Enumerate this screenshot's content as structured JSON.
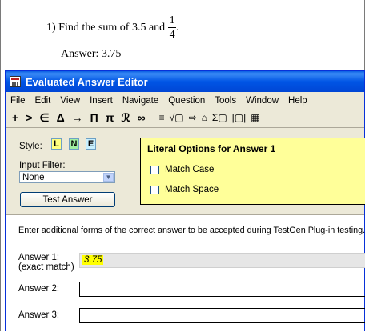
{
  "document": {
    "question_prefix": "1) Find the sum of 3.5 and",
    "fraction_numerator": "1",
    "fraction_denominator": "4",
    "question_suffix": ".",
    "answer_text": "Answer:  3.75"
  },
  "window": {
    "title": "Evaluated Answer Editor",
    "menu": [
      "File",
      "Edit",
      "View",
      "Insert",
      "Navigate",
      "Question",
      "Tools",
      "Window",
      "Help"
    ],
    "toolbar": [
      "+",
      ">",
      "∈",
      "Δ",
      "→",
      "Π",
      "π",
      "ℛ",
      "∞",
      "≡",
      "√▢",
      "⇨",
      "⌂",
      "Σ▢",
      "|▢|",
      "▦"
    ],
    "style_label": "Style:",
    "style_buttons": [
      {
        "label": "L",
        "color": "#ffff80"
      },
      {
        "label": "N",
        "color": "#a0f0a0"
      },
      {
        "label": "E",
        "color": "#c8f0ff"
      }
    ],
    "input_filter_label": "Input Filter:",
    "input_filter_value": "None",
    "test_button": "Test Answer",
    "literal_options_title": "Literal Options for Answer 1",
    "match_case": "Match Case",
    "match_space": "Match Space",
    "instructions": "Enter additional forms of the correct answer to be accepted during TestGen Plug-in testing.",
    "answers": [
      {
        "label": "Answer 1:",
        "sublabel": "(exact match)",
        "value": "3.75"
      },
      {
        "label": "Answer 2:",
        "sublabel": "",
        "value": ""
      },
      {
        "label": "Answer 3:",
        "sublabel": "",
        "value": ""
      }
    ]
  }
}
